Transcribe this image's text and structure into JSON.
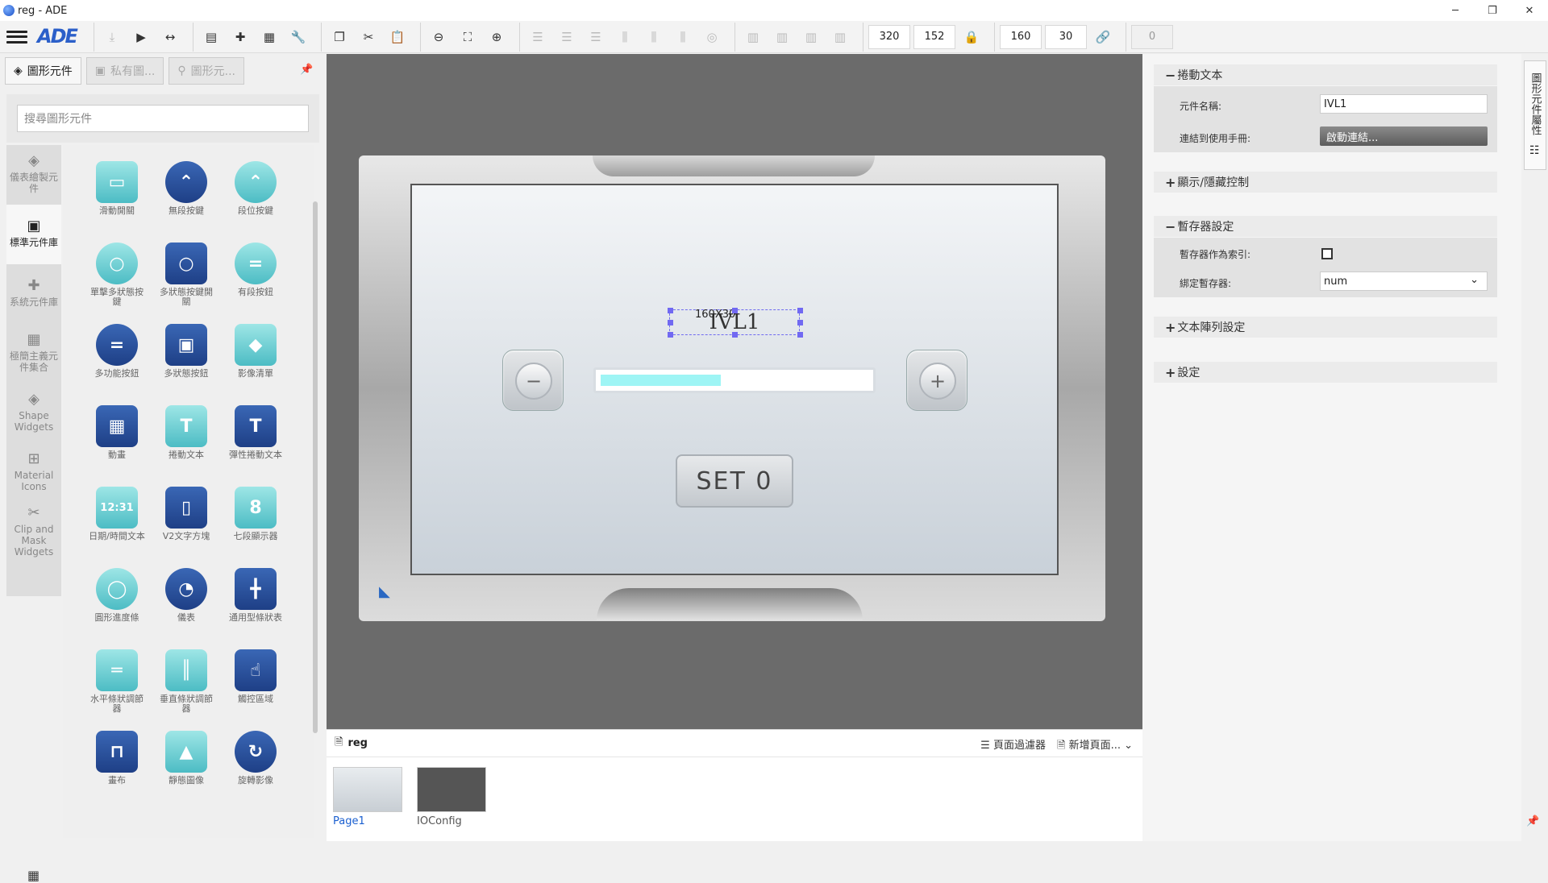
{
  "window": {
    "title": "reg - ADE",
    "min": "─",
    "restore": "❐",
    "close": "✕"
  },
  "toolbar": {
    "x": "320",
    "y": "152",
    "w": "160",
    "h": "30",
    "extra": "0"
  },
  "left": {
    "tabs": [
      {
        "label": "圖形元件",
        "icon": "layers-icon"
      },
      {
        "label": "私有圖...",
        "icon": "briefcase-icon"
      },
      {
        "label": "圖形元...",
        "icon": "pin-icon"
      }
    ],
    "search_placeholder": "搜尋圖形元件",
    "categories": [
      {
        "label": "儀表繪製元件",
        "icon": "layers-icon"
      },
      {
        "label": "標準元件庫",
        "icon": "widget-icon"
      },
      {
        "label": "系統元件庫",
        "icon": "puzzle-icon"
      },
      {
        "label": "極簡主義元件集合",
        "icon": "grid-icon"
      },
      {
        "label": "Shape Widgets",
        "icon": "layers-icon"
      },
      {
        "label": "Material Icons",
        "icon": "grid-icon"
      },
      {
        "label": "Clip and Mask Widgets",
        "icon": "scissors-icon"
      }
    ],
    "widgets": [
      {
        "label": "滑動開關",
        "style": "teal",
        "glyph": "▭"
      },
      {
        "label": "無段按鍵",
        "style": "navy round",
        "glyph": "⌃"
      },
      {
        "label": "段位按鍵",
        "style": "teal round",
        "glyph": "⌃"
      },
      {
        "label": "單擊多狀態按鍵",
        "style": "teal round",
        "glyph": "○"
      },
      {
        "label": "多狀態按鍵開關",
        "style": "navy",
        "glyph": "○"
      },
      {
        "label": "有段按鈕",
        "style": "teal round",
        "glyph": "="
      },
      {
        "label": "多功能按鈕",
        "style": "navy round",
        "glyph": "="
      },
      {
        "label": "多狀態按鈕",
        "style": "navy",
        "glyph": "▣"
      },
      {
        "label": "影像清單",
        "style": "teal",
        "glyph": "◆"
      },
      {
        "label": "動畫",
        "style": "navy",
        "glyph": "▦"
      },
      {
        "label": "捲動文本",
        "style": "teal",
        "glyph": "T"
      },
      {
        "label": "彈性捲動文本",
        "style": "navy",
        "glyph": "T"
      },
      {
        "label": "日期/時間文本",
        "style": "teal",
        "glyph": "12:31"
      },
      {
        "label": "V2文字方塊",
        "style": "navy",
        "glyph": "▯"
      },
      {
        "label": "七段顯示器",
        "style": "teal",
        "glyph": "8"
      },
      {
        "label": "圓形進度條",
        "style": "teal round",
        "glyph": "◯"
      },
      {
        "label": "儀表",
        "style": "navy round",
        "glyph": "◔"
      },
      {
        "label": "通用型條狀表",
        "style": "navy",
        "glyph": "╋"
      },
      {
        "label": "水平條狀調節器",
        "style": "teal",
        "glyph": "═"
      },
      {
        "label": "垂直條狀調節器",
        "style": "teal",
        "glyph": "║"
      },
      {
        "label": "觸控區域",
        "style": "navy",
        "glyph": "☝"
      },
      {
        "label": "畫布",
        "style": "navy",
        "glyph": "⊓"
      },
      {
        "label": "靜態圖像",
        "style": "teal",
        "glyph": "▲"
      },
      {
        "label": "旋轉影像",
        "style": "navy round",
        "glyph": "↻"
      }
    ]
  },
  "canvas": {
    "selected_name": "IVL1",
    "size_label": "160X30",
    "minus": "−",
    "plus": "+",
    "bar_fill": 0.45,
    "set_button": "SET 0"
  },
  "pages": {
    "name": "reg",
    "filter": "頁面過濾器",
    "add": "新增頁面...",
    "items": [
      {
        "label": "Page1"
      },
      {
        "label": "IOConfig"
      }
    ]
  },
  "props": {
    "sec1": "捲動文本",
    "name_label": "元件名稱:",
    "name_value": "IVL1",
    "link_label": "連結到使用手冊:",
    "link_button": "啟動連結...",
    "sec2": "顯示/隱藏控制",
    "sec3": "暫存器設定",
    "index_label": "暫存器作為索引:",
    "bind_label": "綁定暫存器:",
    "bind_value": "num",
    "sec4": "文本陣列設定",
    "sec5": "設定",
    "vtab": "圖形元件屬性"
  }
}
